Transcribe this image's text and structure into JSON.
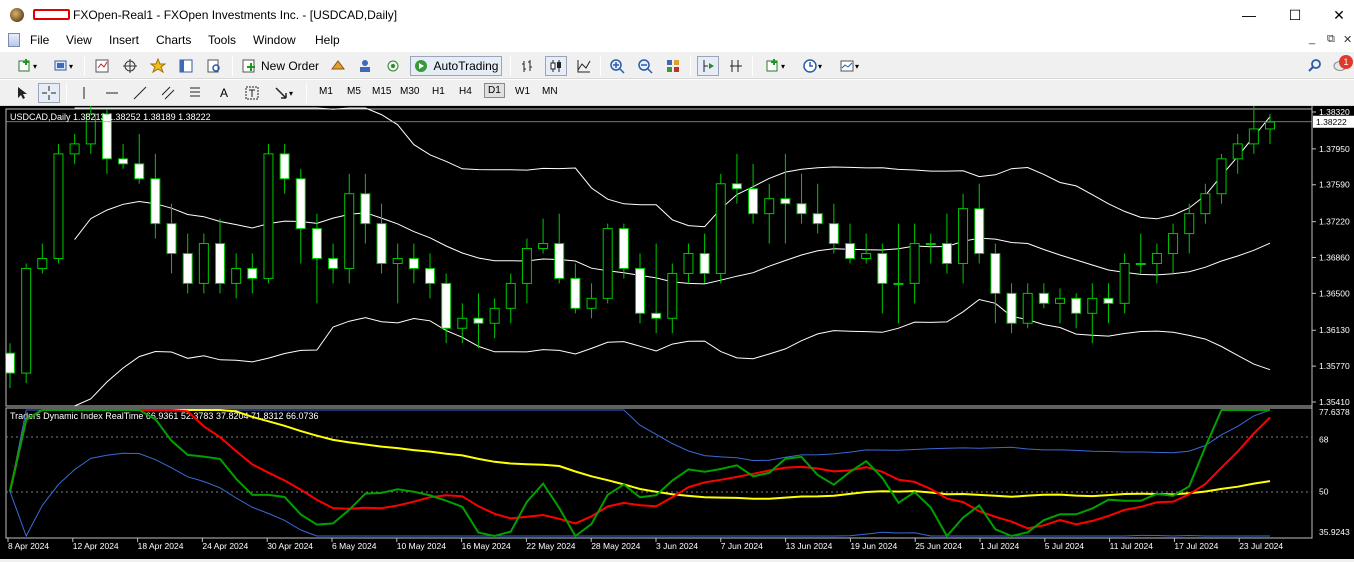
{
  "window": {
    "title": "FXOpen-Real1 - FXOpen Investments Inc. - [USDCAD,Daily]",
    "controls": {
      "minimize": "—",
      "maximize": "☐",
      "close": "✕"
    }
  },
  "menu": [
    "File",
    "View",
    "Insert",
    "Charts",
    "Tools",
    "Window",
    "Help"
  ],
  "toolbar": {
    "new_order": "New Order",
    "auto_trading": "AutoTrading",
    "timeframes": [
      "M1",
      "M5",
      "M15",
      "M30",
      "H1",
      "H4",
      "D1",
      "W1",
      "MN"
    ],
    "active_timeframe": "D1",
    "notification_count": "1"
  },
  "chart": {
    "header": "USDCAD,Daily  1.38213 1.38252 1.38189 1.38222",
    "current_price": "1.38222",
    "price_axis": [
      "1.38320",
      "1.37950",
      "1.37590",
      "1.37220",
      "1.36860",
      "1.36500",
      "1.36130",
      "1.35770",
      "1.35410"
    ],
    "date_axis": [
      "8 Apr 2024",
      "12 Apr 2024",
      "18 Apr 2024",
      "24 Apr 2024",
      "30 Apr 2024",
      "6 May 2024",
      "10 May 2024",
      "16 May 2024",
      "22 May 2024",
      "28 May 2024",
      "3 Jun 2024",
      "7 Jun 2024",
      "13 Jun 2024",
      "19 Jun 2024",
      "25 Jun 2024",
      "1 Jul 2024",
      "5 Jul 2024",
      "11 Jul 2024",
      "17 Jul 2024",
      "23 Jul 2024"
    ]
  },
  "indicator": {
    "header": "Traders Dynamic Index RealTime 66.9361 52.3783 37.8204 71.8312 66.0736",
    "axis": [
      "77.6378",
      "68",
      "50",
      "35.9243"
    ]
  },
  "chart_data": {
    "type": "candlestick",
    "symbol": "USDCAD",
    "timeframe": "Daily",
    "ylim": [
      1.3541,
      1.3832
    ],
    "last_ohlc": {
      "open": 1.38213,
      "high": 1.38252,
      "low": 1.38189,
      "close": 1.38222
    },
    "candles": [
      [
        1.359,
        1.36,
        1.3555,
        1.357
      ],
      [
        1.357,
        1.368,
        1.356,
        1.3675
      ],
      [
        1.3675,
        1.37,
        1.367,
        1.3685
      ],
      [
        1.3685,
        1.38,
        1.368,
        1.379
      ],
      [
        1.379,
        1.381,
        1.378,
        1.38
      ],
      [
        1.38,
        1.384,
        1.379,
        1.383
      ],
      [
        1.383,
        1.3835,
        1.377,
        1.3785
      ],
      [
        1.3785,
        1.38,
        1.3775,
        1.378
      ],
      [
        1.378,
        1.381,
        1.376,
        1.3765
      ],
      [
        1.3765,
        1.379,
        1.3705,
        1.372
      ],
      [
        1.372,
        1.374,
        1.367,
        1.369
      ],
      [
        1.369,
        1.371,
        1.365,
        1.366
      ],
      [
        1.366,
        1.371,
        1.365,
        1.37
      ],
      [
        1.37,
        1.3725,
        1.365,
        1.366
      ],
      [
        1.366,
        1.369,
        1.3645,
        1.3675
      ],
      [
        1.3675,
        1.369,
        1.365,
        1.3665
      ],
      [
        1.3665,
        1.38,
        1.366,
        1.379
      ],
      [
        1.379,
        1.38,
        1.375,
        1.3765
      ],
      [
        1.3765,
        1.3775,
        1.368,
        1.3715
      ],
      [
        1.3715,
        1.373,
        1.364,
        1.3685
      ],
      [
        1.3685,
        1.37,
        1.366,
        1.3675
      ],
      [
        1.3675,
        1.377,
        1.366,
        1.375
      ],
      [
        1.375,
        1.377,
        1.37,
        1.372
      ],
      [
        1.372,
        1.374,
        1.367,
        1.368
      ],
      [
        1.368,
        1.37,
        1.364,
        1.3685
      ],
      [
        1.3685,
        1.37,
        1.366,
        1.3675
      ],
      [
        1.3675,
        1.369,
        1.3645,
        1.366
      ],
      [
        1.366,
        1.367,
        1.36,
        1.3615
      ],
      [
        1.3615,
        1.364,
        1.36,
        1.3625
      ],
      [
        1.3625,
        1.365,
        1.3595,
        1.362
      ],
      [
        1.362,
        1.3645,
        1.3605,
        1.3635
      ],
      [
        1.3635,
        1.367,
        1.362,
        1.366
      ],
      [
        1.366,
        1.3705,
        1.364,
        1.3695
      ],
      [
        1.3695,
        1.3725,
        1.369,
        1.37
      ],
      [
        1.37,
        1.373,
        1.366,
        1.3665
      ],
      [
        1.3665,
        1.368,
        1.363,
        1.3635
      ],
      [
        1.3635,
        1.366,
        1.3625,
        1.3645
      ],
      [
        1.3645,
        1.372,
        1.364,
        1.3715
      ],
      [
        1.3715,
        1.372,
        1.3665,
        1.3675
      ],
      [
        1.3675,
        1.369,
        1.362,
        1.363
      ],
      [
        1.363,
        1.37,
        1.361,
        1.3625
      ],
      [
        1.3625,
        1.368,
        1.361,
        1.367
      ],
      [
        1.367,
        1.37,
        1.366,
        1.369
      ],
      [
        1.369,
        1.371,
        1.366,
        1.367
      ],
      [
        1.367,
        1.377,
        1.366,
        1.376
      ],
      [
        1.376,
        1.379,
        1.374,
        1.3755
      ],
      [
        1.3755,
        1.378,
        1.372,
        1.373
      ],
      [
        1.373,
        1.376,
        1.37,
        1.3745
      ],
      [
        1.3745,
        1.379,
        1.37,
        1.374
      ],
      [
        1.374,
        1.377,
        1.372,
        1.373
      ],
      [
        1.373,
        1.376,
        1.371,
        1.372
      ],
      [
        1.372,
        1.374,
        1.369,
        1.37
      ],
      [
        1.37,
        1.372,
        1.368,
        1.3685
      ],
      [
        1.3685,
        1.371,
        1.368,
        1.369
      ],
      [
        1.369,
        1.37,
        1.363,
        1.366
      ],
      [
        1.366,
        1.372,
        1.362,
        1.366
      ],
      [
        1.366,
        1.372,
        1.364,
        1.37
      ],
      [
        1.37,
        1.371,
        1.368,
        1.37
      ],
      [
        1.37,
        1.373,
        1.367,
        1.368
      ],
      [
        1.368,
        1.375,
        1.366,
        1.3735
      ],
      [
        1.3735,
        1.376,
        1.368,
        1.369
      ],
      [
        1.369,
        1.37,
        1.362,
        1.365
      ],
      [
        1.365,
        1.366,
        1.361,
        1.362
      ],
      [
        1.362,
        1.366,
        1.3615,
        1.365
      ],
      [
        1.365,
        1.366,
        1.3635,
        1.364
      ],
      [
        1.364,
        1.3655,
        1.362,
        1.3645
      ],
      [
        1.3645,
        1.365,
        1.3615,
        1.363
      ],
      [
        1.363,
        1.366,
        1.36,
        1.3645
      ],
      [
        1.3645,
        1.366,
        1.362,
        1.364
      ],
      [
        1.364,
        1.369,
        1.363,
        1.368
      ],
      [
        1.368,
        1.371,
        1.367,
        1.368
      ],
      [
        1.368,
        1.37,
        1.366,
        1.369
      ],
      [
        1.369,
        1.372,
        1.367,
        1.371
      ],
      [
        1.371,
        1.374,
        1.369,
        1.373
      ],
      [
        1.373,
        1.376,
        1.372,
        1.375
      ],
      [
        1.375,
        1.379,
        1.374,
        1.3785
      ],
      [
        1.3785,
        1.381,
        1.377,
        1.38
      ],
      [
        1.38,
        1.384,
        1.379,
        1.3815
      ],
      [
        1.3815,
        1.383,
        1.38,
        1.3822
      ]
    ],
    "indicator_ylim": [
      35.9243,
      77.6378
    ],
    "indicator_levels": [
      68,
      50
    ]
  }
}
